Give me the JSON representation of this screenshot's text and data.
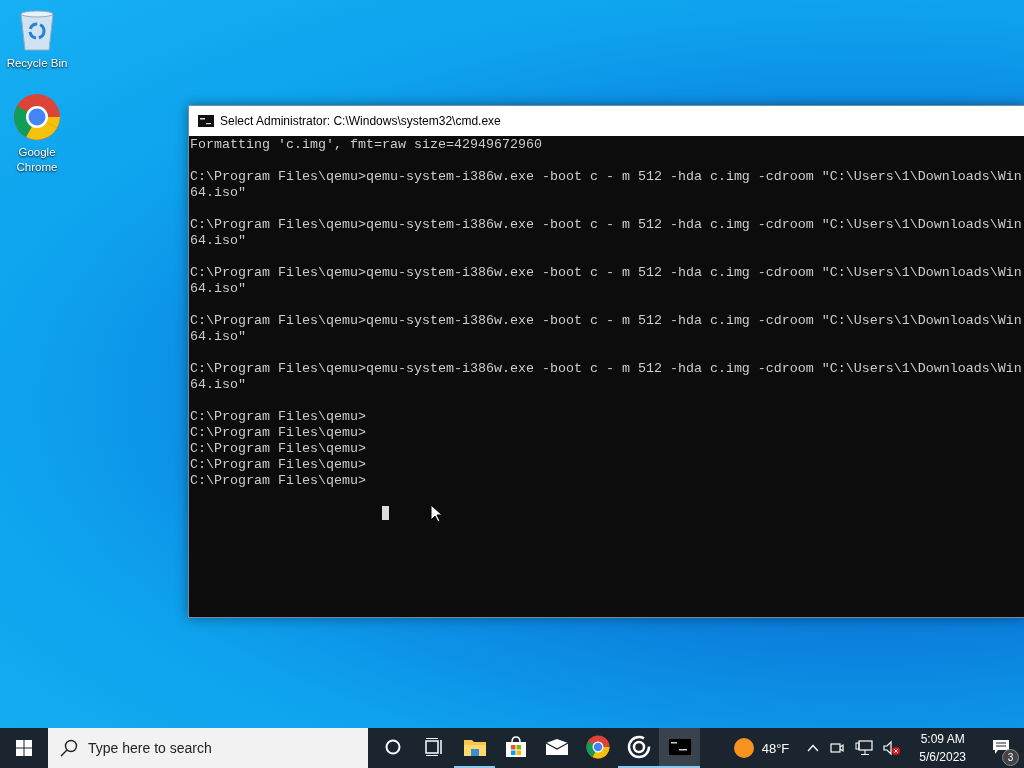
{
  "desktop_icons": [
    {
      "kind": "recycle",
      "label": "Recycle Bin"
    },
    {
      "kind": "chrome",
      "label": "Google Chrome"
    }
  ],
  "console_window": {
    "title": "Select Administrator: C:\\Windows\\system32\\cmd.exe",
    "blocks": [
      [
        "Formatting 'c.img', fmt=raw size=42949672960"
      ],
      [
        "C:\\Program Files\\qemu>qemu-system-i386w.exe -boot c - m 512 -hda c.img -cdroom \"C:\\Users\\1\\Downloads\\Win",
        "64.iso\""
      ],
      [
        "C:\\Program Files\\qemu>qemu-system-i386w.exe -boot c - m 512 -hda c.img -cdroom \"C:\\Users\\1\\Downloads\\Win",
        "64.iso\""
      ],
      [
        "C:\\Program Files\\qemu>qemu-system-i386w.exe -boot c - m 512 -hda c.img -cdroom \"C:\\Users\\1\\Downloads\\Win",
        "64.iso\""
      ],
      [
        "C:\\Program Files\\qemu>qemu-system-i386w.exe -boot c - m 512 -hda c.img -cdroom \"C:\\Users\\1\\Downloads\\Win",
        "64.iso\""
      ],
      [
        "C:\\Program Files\\qemu>qemu-system-i386w.exe -boot c - m 512 -hda c.img -cdroom \"C:\\Users\\1\\Downloads\\Win",
        "64.iso\""
      ],
      [
        "C:\\Program Files\\qemu>",
        "C:\\Program Files\\qemu>",
        "C:\\Program Files\\qemu>",
        "C:\\Program Files\\qemu>",
        "C:\\Program Files\\qemu>"
      ]
    ]
  },
  "taskbar": {
    "search": {
      "placeholder": "Type here to search"
    },
    "apps": [
      {
        "kind": "cortana",
        "running": false,
        "selected": false
      },
      {
        "kind": "taskview",
        "running": false,
        "selected": false
      },
      {
        "kind": "explorer",
        "running": true,
        "selected": false
      },
      {
        "kind": "store",
        "running": false,
        "selected": false
      },
      {
        "kind": "mail",
        "running": false,
        "selected": false
      },
      {
        "kind": "chrome",
        "running": false,
        "selected": false
      },
      {
        "kind": "media",
        "running": true,
        "selected": false
      },
      {
        "kind": "cmd",
        "running": true,
        "selected": true
      }
    ],
    "weather": {
      "temperature": "48°F"
    },
    "time": "5:09 AM",
    "date": "5/6/2023",
    "notification_count": "3"
  }
}
